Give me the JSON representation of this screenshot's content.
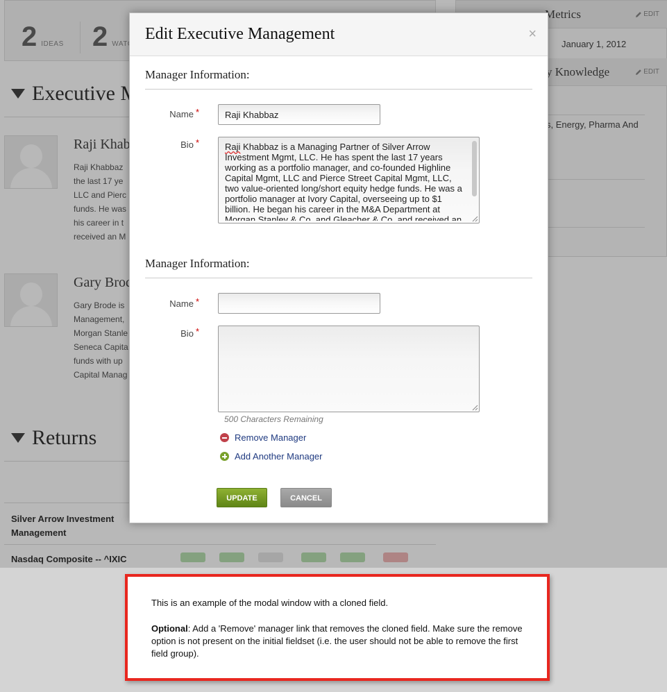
{
  "background": {
    "stats": [
      {
        "number": "2",
        "label": "IDEAS"
      },
      {
        "number": "2",
        "label": "WATC"
      }
    ],
    "sections": {
      "executive": "Executive M",
      "returns": "Returns"
    },
    "managers": [
      {
        "name": "Raji Khabb",
        "bio_lines": [
          "Raji Khabbaz",
          "the last 17 ye",
          "LLC and Pierc",
          "funds. He was",
          "his career in t",
          "received an M"
        ]
      },
      {
        "name": "Gary Brode",
        "bio_lines": [
          "Gary Brode is",
          "Management,",
          "Morgan Stanle",
          "Seneca Capita",
          "funds with up",
          "Capital Manag"
        ]
      }
    ],
    "right_panel": {
      "metrics_title": "Metrics",
      "metrics_edit": "EDIT",
      "date": "January 1, 2012",
      "knowledge_title": "y Knowledge",
      "knowledge_edit": "EDIT",
      "knowledge_text": "s, Energy, Pharma And"
    },
    "returns": {
      "row1": "Silver Arrow Investment Management",
      "row2": "Nasdaq Composite -- ^IXIC"
    }
  },
  "modal": {
    "title": "Edit Executive Management",
    "close_symbol": "×",
    "fieldsets": [
      {
        "legend": "Manager Information:",
        "name_label": "Name",
        "name_value": "Raji Khabbaz",
        "bio_label": "Bio",
        "bio_value": "is a Managing Partner of Silver Arrow Investment Mgmt, LLC. He has spent the last 17 years working as a portfolio manager, and co-founded Highline Capital Mgmt, LLC and Pierce Street Capital Mgmt, LLC, two value-oriented long/short equity hedge funds. He was a portfolio manager at Ivory Capital, overseeing up to $1 billion. He began his career in the M&A Department at Morgan Stanley & Co. and Gleacher & Co. and received an"
      },
      {
        "legend": "Manager Information:",
        "name_label": "Name",
        "name_value": "",
        "bio_label": "Bio",
        "bio_value": ""
      }
    ],
    "required_marker": "*",
    "chars_remaining": "500 Characters Remaining",
    "remove_link": "Remove Manager",
    "add_link": "Add Another Manager",
    "update_button": "UPDATE",
    "cancel_button": "CANCEL"
  },
  "note": {
    "paragraph1": "This is an example of the modal window with a cloned field.",
    "optional_label": "Optional",
    "paragraph2": ": Add a 'Remove' manager link that removes the cloned field. Make sure the remove option is not present on the initial fieldset (i.e. the user should not be able to remove the first field group)."
  },
  "colors": {
    "required": "#cc0000",
    "link": "#1f3a80",
    "update_button": "#6f951f",
    "cancel_button": "#999999",
    "note_border": "#e8271f",
    "remove_icon": "#c0414a",
    "add_icon": "#7aa12c"
  }
}
